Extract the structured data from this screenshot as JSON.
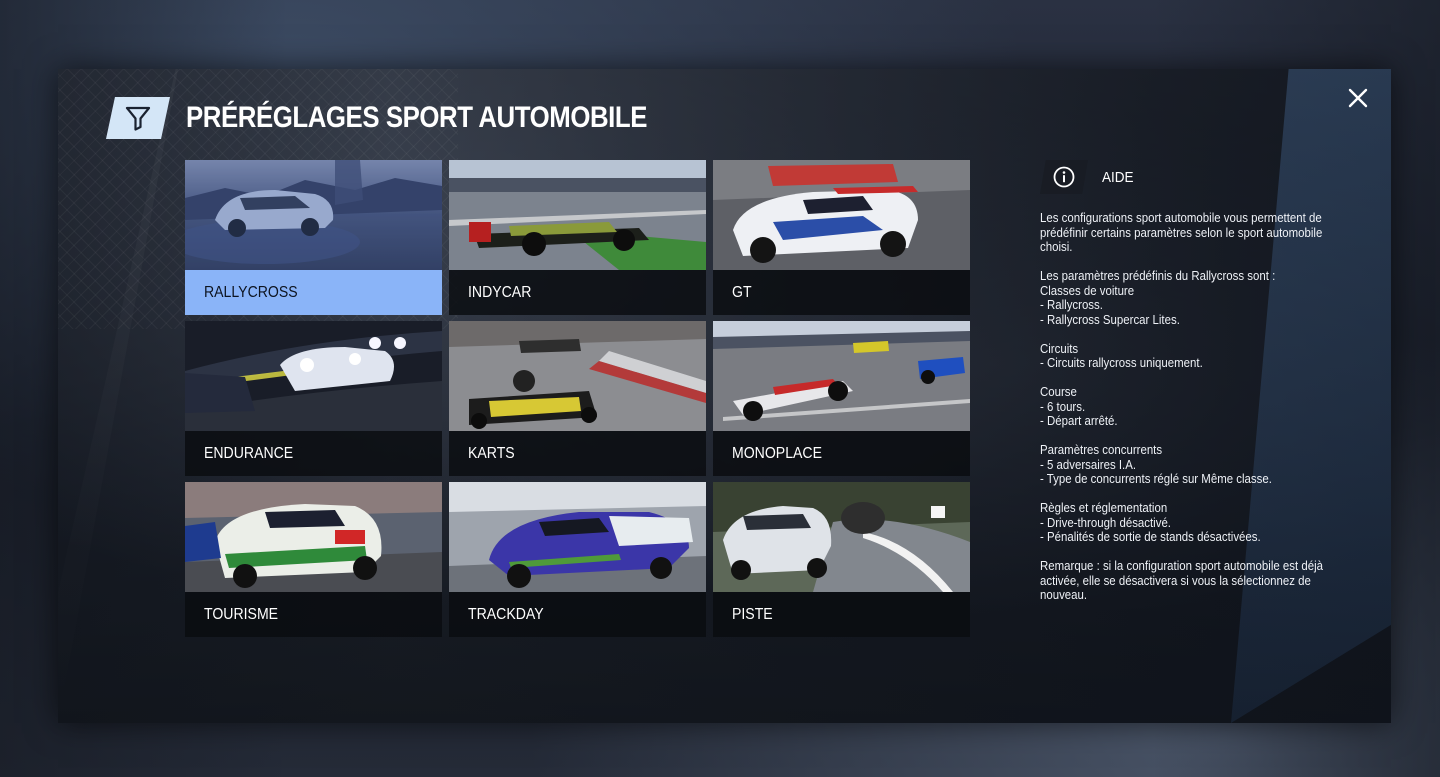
{
  "dialog": {
    "title": "PRÉRÉGLAGES SPORT AUTOMOBILE"
  },
  "icons": {
    "filter": "filter-funnel-icon",
    "close": "close-x-icon",
    "info": "info-circle-icon"
  },
  "colors": {
    "selected_tile": "#8ab4f8",
    "filter_badge": "#d4e6f7",
    "label_bar": "#0a0c10"
  },
  "presets": [
    {
      "label": "RALLYCROSS",
      "selected": true
    },
    {
      "label": "INDYCAR",
      "selected": false
    },
    {
      "label": "GT",
      "selected": false
    },
    {
      "label": "ENDURANCE",
      "selected": false
    },
    {
      "label": "KARTS",
      "selected": false
    },
    {
      "label": "MONOPLACE",
      "selected": false
    },
    {
      "label": "TOURISME",
      "selected": false
    },
    {
      "label": "TRACKDAY",
      "selected": false
    },
    {
      "label": "PISTE",
      "selected": false
    }
  ],
  "help": {
    "title": "AIDE",
    "blocks": [
      [
        "Les configurations sport automobile vous permettent de",
        "prédéfinir certains paramètres selon le sport automobile",
        "choisi."
      ],
      [
        "Les paramètres prédéfinis du Rallycross sont :",
        "Classes de voiture",
        "- Rallycross.",
        "- Rallycross Supercar Lites."
      ],
      [
        "Circuits",
        "- Circuits rallycross uniquement."
      ],
      [
        "Course",
        "- 6 tours.",
        "- Départ arrêté."
      ],
      [
        "Paramètres concurrents",
        "- 5 adversaires I.A.",
        "- Type de concurrents réglé sur Même classe."
      ],
      [
        "Règles et réglementation",
        "- Drive-through désactivé.",
        "- Pénalités de sortie de stands désactivées."
      ],
      [
        "Remarque : si la configuration sport automobile est déjà",
        "activée, elle se désactivera si vous la sélectionnez de",
        "nouveau."
      ]
    ]
  }
}
